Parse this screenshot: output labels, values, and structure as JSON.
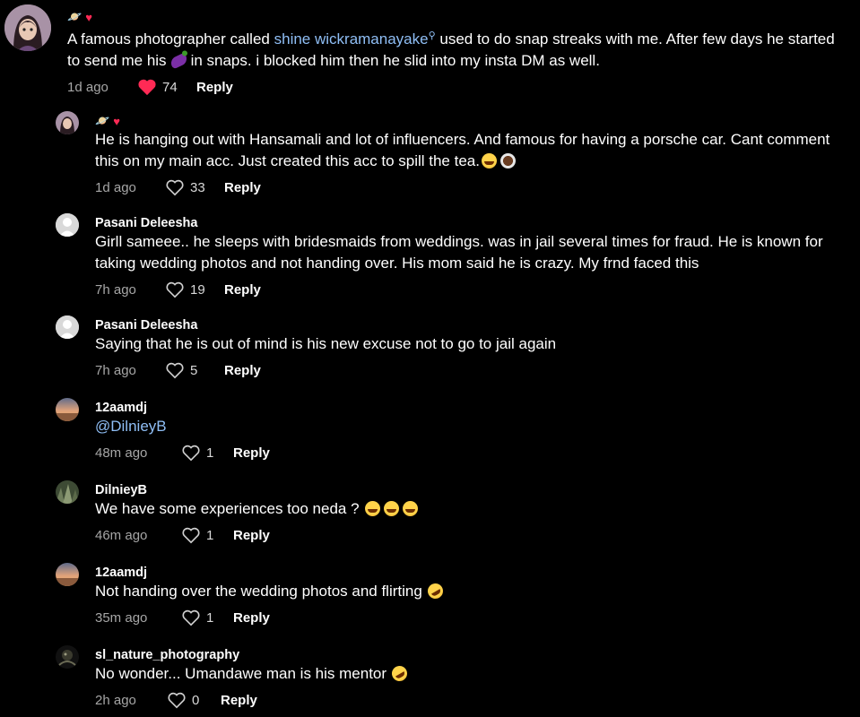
{
  "comments": [
    {
      "type": "top",
      "text_before": "A famous photographer called ",
      "link": "shine wickramanayake",
      "text_mid": " used to do snap streaks with me. After few days he started to send me his",
      "text_after": "in snaps. i blocked him then he slid into my insta DM as well.",
      "time": "1d ago",
      "likes": "74",
      "reply": "Reply"
    },
    {
      "type": "reply",
      "text": "He is hanging out with Hansamali and lot of influencers. And famous for having a porsche car. Cant comment this on my main acc. Just created this acc to spill the tea.",
      "time": "1d ago",
      "likes": "33",
      "reply": "Reply"
    },
    {
      "type": "reply",
      "username": "Pasani Deleesha",
      "text": "Girll sameee.. he sleeps with bridesmaids from weddings. was in jail several times for fraud. He is known for taking wedding photos and not handing over. His mom said he is crazy. My frnd faced this",
      "time": "7h ago",
      "likes": "19",
      "reply": "Reply"
    },
    {
      "type": "reply",
      "username": "Pasani Deleesha",
      "text": "Saying that he is out of mind is his new excuse not to go to jail again",
      "time": "7h ago",
      "likes": "5",
      "reply": "Reply"
    },
    {
      "type": "reply",
      "username": "12aamdj",
      "mention": "@DilnieyB",
      "time": "48m ago",
      "likes": "1",
      "reply": "Reply"
    },
    {
      "type": "reply",
      "username": "DilnieyB",
      "text": "We have some experiences too neda ?",
      "time": "46m ago",
      "likes": "1",
      "reply": "Reply"
    },
    {
      "type": "reply",
      "username": "12aamdj",
      "text": "Not handing over the wedding photos and flirting",
      "time": "35m ago",
      "likes": "1",
      "reply": "Reply"
    },
    {
      "type": "reply",
      "username": "sl_nature_photography",
      "text": "No wonder... Umandawe man is his mentor",
      "time": "2h ago",
      "likes": "0",
      "reply": "Reply"
    }
  ],
  "colors": {
    "background": "#000000",
    "link": "#8fbef5",
    "like_red": "#ff2a55",
    "muted": "#a6a6a6"
  }
}
